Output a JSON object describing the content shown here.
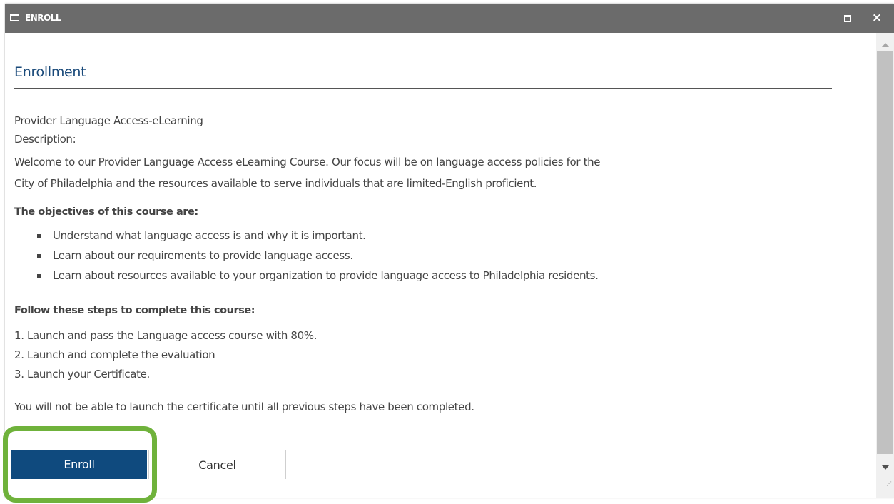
{
  "window": {
    "title": "ENROLL",
    "icon": "window-icon",
    "maximize_icon": "maximize-icon",
    "close_symbol": "×",
    "close_icon": "close-icon"
  },
  "content": {
    "heading": "Enrollment",
    "course_name": "Provider Language Access-eLearning",
    "description_label": "Description:",
    "description_line1": "Welcome to our Provider Language Access eLearning Course.  Our focus will be on language access policies for the",
    "description_line2": "City of Philadelphia and the resources available to serve individuals that are limited-English proficient.",
    "objectives_heading": "The objectives of this course are:",
    "objectives": [
      "Understand what language access is and why it is important.",
      "Learn about our requirements to provide language access.",
      "Learn about resources available to your organization to provide language access to Philadelphia residents."
    ],
    "steps_heading": "Follow these steps to complete this course:",
    "steps": [
      "1. Launch and pass the Language access course with 80%.",
      "2. Launch and complete the evaluation",
      "3. Launch your Certificate."
    ],
    "note": "You will not be able to launch the certificate until all previous steps have been completed."
  },
  "buttons": {
    "enroll": "Enroll",
    "cancel": "Cancel"
  },
  "colors": {
    "titlebar": "#6b6b6b",
    "heading": "#1a4a7a",
    "enroll_button": "#0f4a7e",
    "highlight": "#6fb23b"
  }
}
